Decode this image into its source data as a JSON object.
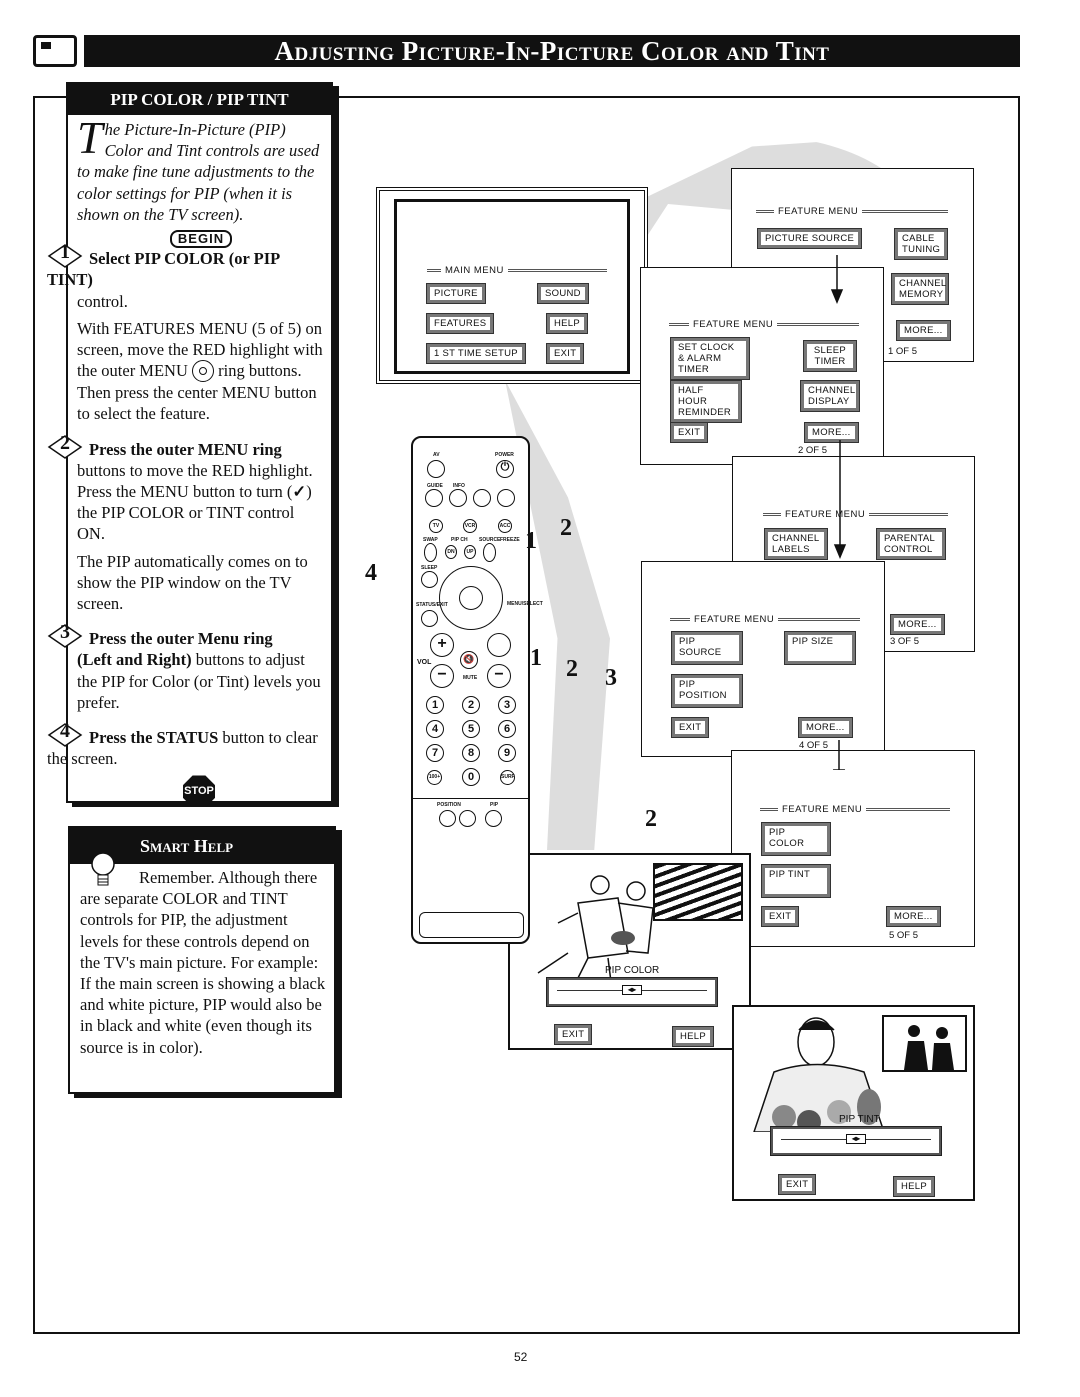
{
  "header": {
    "title": "Adjusting Picture-In-Picture Color and Tint",
    "icon": "tv-icon"
  },
  "left_panel": {
    "heading": "PIP COLOR / PIP TINT",
    "intro_dropcap": "T",
    "intro": "he Picture-In-Picture (PIP) Color and Tint controls are used to make fine tune adjustments to the color settings for PIP (when it is shown on the TV screen).",
    "begin_label": "BEGIN",
    "steps": [
      {
        "num": "1",
        "title": "Select PIP COLOR (or PIP TINT)",
        "title_tail": " control.",
        "text": "With FEATURES MENU (5 of 5) on screen, move the RED highlight with the outer MENU",
        "text2": " ring buttons. Then press the center MENU button to select the feature."
      },
      {
        "num": "2",
        "title": "Press the outer MENU ring",
        "text": " buttons to move the RED highlight. Press the MENU button to turn (",
        "check": "✓",
        "text2": ") the  PIP COLOR or TINT control ON.",
        "text3": "The PIP automatically comes on to show the PIP window on the TV screen."
      },
      {
        "num": "3",
        "title": "Press the outer Menu ring",
        "title2": "(Left and Right)",
        "text": " buttons to adjust the PIP for Color (or Tint) levels you prefer."
      },
      {
        "num": "4",
        "title": "Press the STATUS",
        "text": " button to clear the screen."
      }
    ],
    "stop_label": "STOP"
  },
  "smart_help": {
    "heading": "Smart Help",
    "text": "Remember. Although there are separate COLOR and TINT controls for PIP, the adjustment levels for these controls depend on the TV's main picture. For example: If the main screen is showing a black and white picture, PIP would also be in black and white (even though its source is in color)."
  },
  "main_menu": {
    "title": "MAIN MENU",
    "buttons": [
      "PICTURE",
      "SOUND",
      "FEATURES",
      "HELP",
      "1 ST TIME SETUP",
      "EXIT"
    ]
  },
  "feature_menus": [
    {
      "title": "FEATURE MENU",
      "buttons": [
        "PICTURE SOURCE",
        "CABLE TUNING",
        "CHANNEL MEMORY",
        "MORE..."
      ],
      "page": "1  OF 5"
    },
    {
      "title": "FEATURE MENU",
      "buttons": [
        "SET CLOCK & ALARM TIMER",
        "SLEEP TIMER",
        "HALF HOUR REMINDER",
        "CHANNEL DISPLAY",
        "EXIT",
        "MORE..."
      ],
      "page": "2  OF 5"
    },
    {
      "title": "FEATURE MENU",
      "buttons": [
        "CHANNEL LABELS",
        "PARENTAL CONTROL",
        "MORE..."
      ],
      "page": "3  OF 5"
    },
    {
      "title": "FEATURE MENU",
      "buttons": [
        "PIP SOURCE",
        "PIP SIZE",
        "PIP POSITION",
        "EXIT",
        "MORE..."
      ],
      "page": "4  OF 5"
    },
    {
      "title": "FEATURE MENU",
      "buttons": [
        "PIP COLOR",
        "PIP TINT",
        "EXIT",
        "MORE..."
      ],
      "page": "5  OF 5"
    }
  ],
  "pip_color_screen": {
    "label": "PIP COLOR",
    "exit": "EXIT",
    "help": "HELP",
    "level": 0.5
  },
  "pip_tint_screen": {
    "label": "PIP TINT",
    "exit": "EXIT",
    "help": "HELP",
    "level": 0.5
  },
  "remote": {
    "labels": [
      "AV",
      "POWER",
      "GUIDE",
      "INFO",
      "SWAP",
      "PIP CH",
      "SOURCE",
      "FREEZE",
      "SLEEP",
      "STATUS/EXIT",
      "MENU/SELECT",
      "VOL",
      "MUTE",
      "POSITION",
      "PIP"
    ],
    "small_buttons": [
      "TV",
      "VCR",
      "ACC"
    ],
    "ch": [
      "DN",
      "UP"
    ],
    "digits": [
      "1",
      "2",
      "3",
      "4",
      "5",
      "6",
      "7",
      "8",
      "9",
      "100+",
      "0",
      "SURF"
    ]
  },
  "callouts": [
    "1",
    "2",
    "4",
    "1",
    "2",
    "3",
    "2"
  ],
  "page_number": "52"
}
